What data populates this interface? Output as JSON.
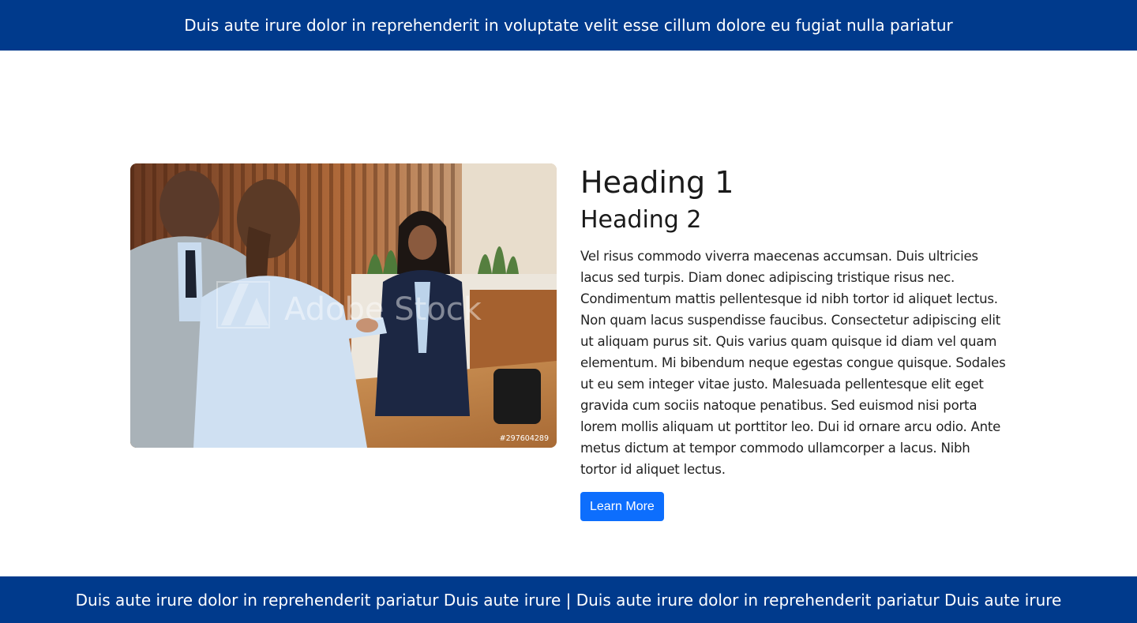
{
  "top_banner": {
    "text": "Duis aute irure dolor in reprehenderit in voluptate velit esse cillum dolore eu fugiat nulla pariatur"
  },
  "hero_image": {
    "watermark": "Adobe Stock",
    "stock_id": "#297604289"
  },
  "content": {
    "heading1": "Heading 1",
    "heading2": "Heading 2",
    "body": "Vel risus commodo viverra maecenas accumsan. Duis ultricies lacus sed turpis. Diam donec adipiscing tristique risus nec. Condimentum mattis pellentesque id nibh tortor id aliquet lectus. Non quam lacus suspendisse faucibus. Consectetur adipiscing elit ut aliquam purus sit. Quis varius quam quisque id diam vel quam elementum. Mi bibendum neque egestas congue quisque. Sodales ut eu sem integer vitae justo. Malesuada pellentesque elit eget gravida cum sociis natoque penatibus. Sed euismod nisi porta lorem mollis aliquam ut porttitor leo. Dui id ornare arcu odio. Ante metus dictum at tempor commodo ullamcorper a lacus. Nibh tortor id aliquet lectus.",
    "button_label": "Learn More"
  },
  "bottom_banner": {
    "text": "Duis aute irure dolor in reprehenderit pariatur Duis aute irure | Duis aute irure dolor in reprehenderit pariatur Duis aute irure"
  },
  "colors": {
    "banner_bg": "#003a8c",
    "button_bg": "#0d6efd"
  }
}
